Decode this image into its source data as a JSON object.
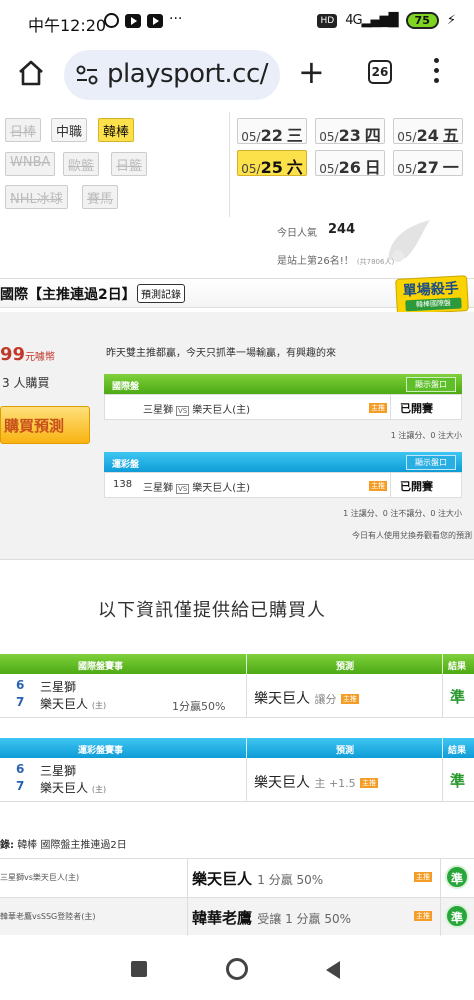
{
  "status_bar": {
    "time": "中午12:20",
    "icons": [
      "alarm-icon",
      "youtube-icon",
      "youtube-icon",
      "more-dots-icon"
    ],
    "network": "4G",
    "battery": "75"
  },
  "browser": {
    "url": "playsport.cc/",
    "tab_count": "26"
  },
  "sports": {
    "row1": [
      "日棒",
      "中職",
      "韓棒"
    ],
    "row2": [
      "WNBA",
      "歐籃",
      "日籃"
    ],
    "row3": [
      "NHL冰球",
      "賽馬"
    ],
    "active": "韓棒"
  },
  "dates": [
    {
      "prefix": "05/",
      "day": "22",
      "weekday": "三"
    },
    {
      "prefix": "05/",
      "day": "23",
      "weekday": "四"
    },
    {
      "prefix": "05/",
      "day": "24",
      "weekday": "五"
    },
    {
      "prefix": "05/",
      "day": "25",
      "weekday": "六",
      "active": true
    },
    {
      "prefix": "05/",
      "day": "26",
      "weekday": "日"
    },
    {
      "prefix": "05/",
      "day": "27",
      "weekday": "一"
    }
  ],
  "popularity": {
    "label": "今日人氣",
    "count": "244",
    "rank_text": "是站上第26名!！",
    "rank_sub": "(共7806人)"
  },
  "header": {
    "title": "國際【主推連過2日】",
    "record_btn": "預測記錄",
    "badge_main": "單場殺手",
    "badge_sub": "韓棒國際盤"
  },
  "panel": {
    "price": "99",
    "price_unit": "元噱幣",
    "buyers": "3 人購買",
    "buy_btn": "購買預測",
    "note": "昨天雙主推都贏，今天只抓準一場輸贏，有興趣的來",
    "intl": {
      "title": "國際盤",
      "show_btn": "顯示盤口",
      "no": "",
      "home": "三星獅",
      "vs": "VS",
      "away": "樂天巨人(主)",
      "tag": "主推",
      "status": "已開賽",
      "stat": "1 注讓分、0 注大小"
    },
    "lottery": {
      "title": "運彩盤",
      "show_btn": "顯示盤口",
      "no": "138",
      "home": "三星獅",
      "vs": "VS",
      "away": "樂天巨人(主)",
      "tag": "主推",
      "status": "已開賽",
      "stat": "1 注讓分、0 注不讓分、0 注大小"
    },
    "exchange_note": "今日有人使用兌換券觀看您的預測"
  },
  "only_buyers": "以下資訊僅提供給已購買人",
  "intl_table": {
    "col1": "國際盤賽事",
    "col2": "預測",
    "col3": "結果",
    "n1": "6",
    "n2": "7",
    "team1": "三星獅",
    "team2": "樂天巨人",
    "team2_tag": "(主)",
    "rate": "1分贏50%",
    "pick": "樂天巨人",
    "pick_sub": "讓分",
    "tag": "主推",
    "result": "準"
  },
  "lottery_table": {
    "col1": "運彩盤賽事",
    "col2": "預測",
    "col3": "結果",
    "n1": "6",
    "n2": "7",
    "team1": "三星獅",
    "team2": "樂天巨人",
    "team2_tag": "(主)",
    "pick": "樂天巨人",
    "pick_sub": "主 +1.5",
    "tag": "主推",
    "result": "準"
  },
  "history": {
    "title_prefix": "錄:",
    "title": "韓棒 國際盤主推連過2日",
    "rows": [
      {
        "teams": "三星獅vs樂天巨人(主)",
        "pick": "樂天巨人",
        "sub": "1 分贏 50%",
        "tag": "主推",
        "result": "準"
      },
      {
        "teams": "韓華老鷹vsSSG登陸者(主)",
        "pick": "韓華老鷹",
        "sub": "受讓 1 分贏 50%",
        "tag": "主推",
        "result": "準"
      }
    ]
  },
  "colors": {
    "active_yellow": "#fde14a",
    "green_head": "#4ca914",
    "blue_head": "#0f9cd6",
    "result_green": "#29a63a",
    "price_red": "#c0392b"
  }
}
